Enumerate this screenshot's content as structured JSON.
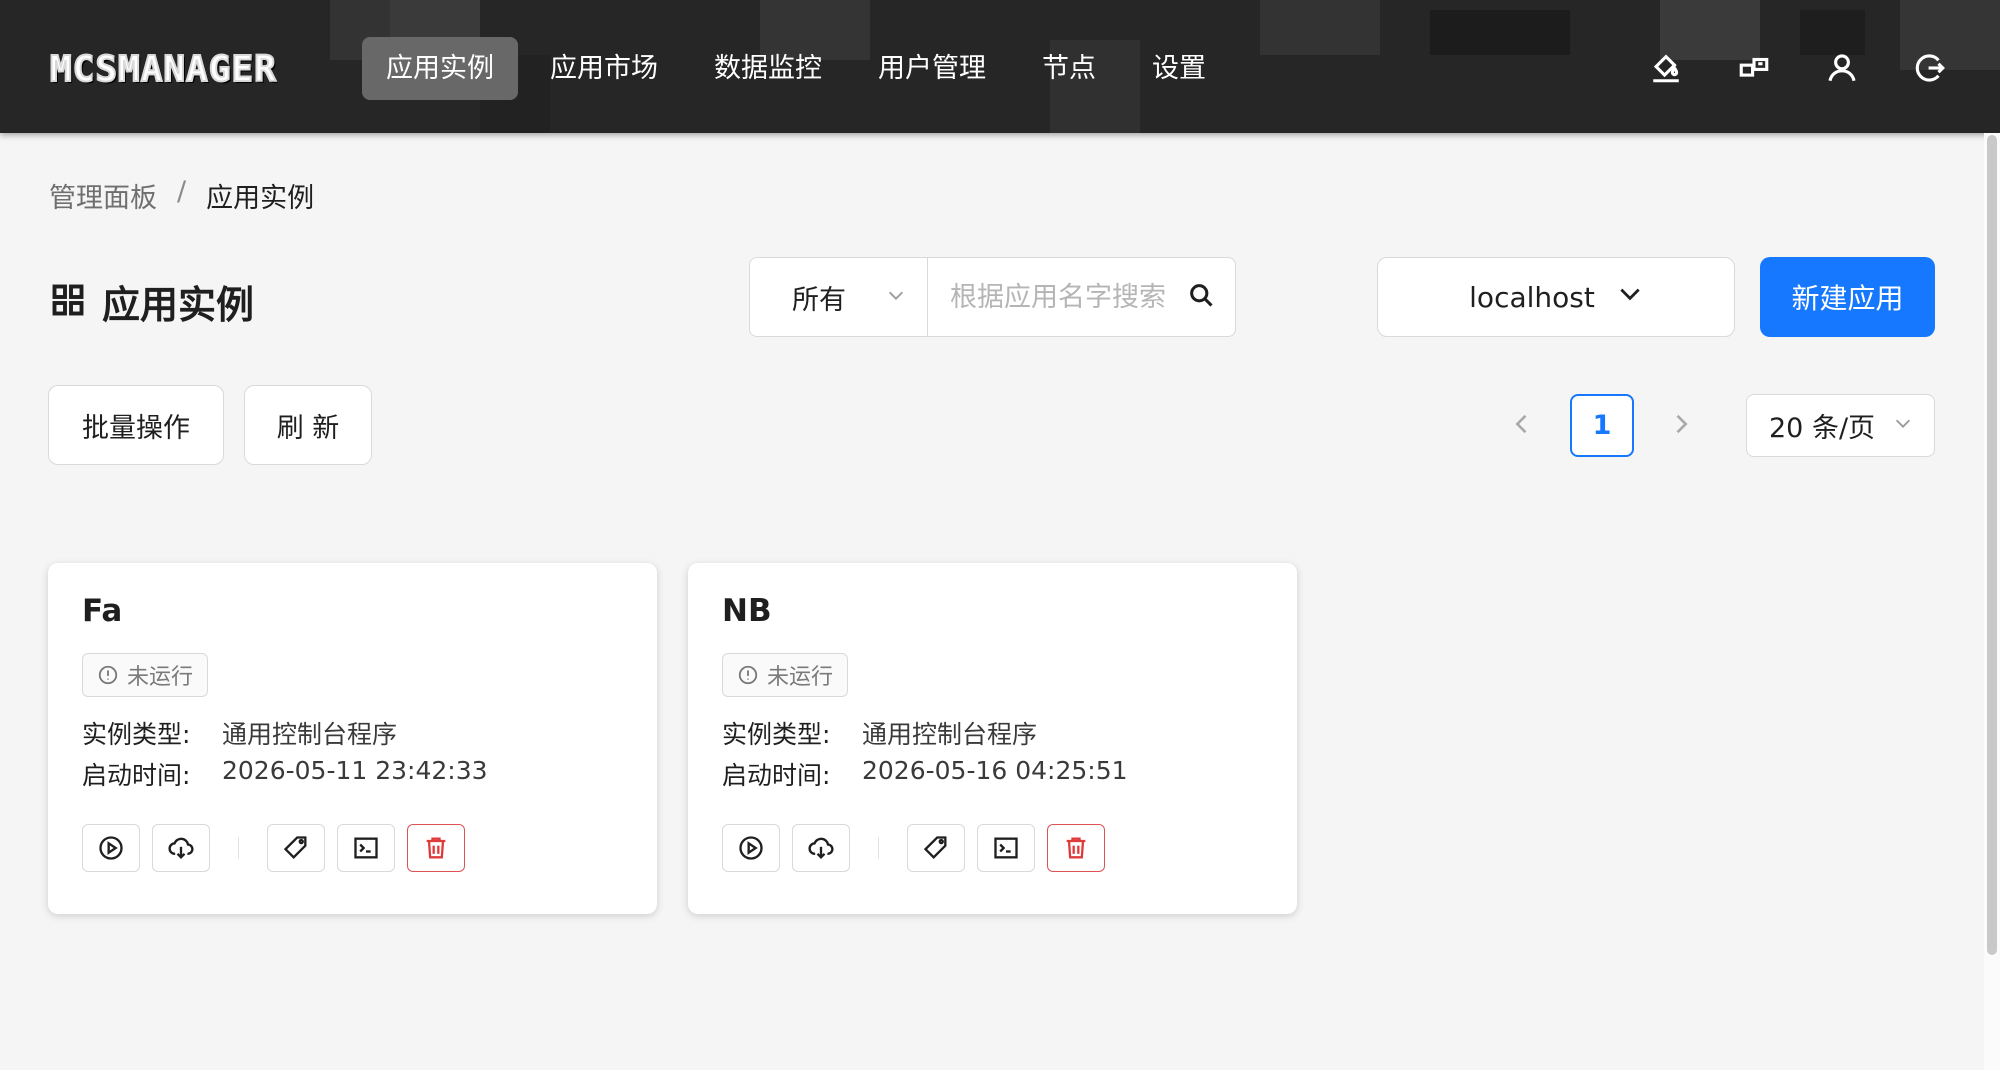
{
  "app": {
    "logo_text": "MCSMANAGER"
  },
  "nav": {
    "items": [
      {
        "label": "应用实例",
        "active": true
      },
      {
        "label": "应用市场",
        "active": false
      },
      {
        "label": "数据监控",
        "active": false
      },
      {
        "label": "用户管理",
        "active": false
      },
      {
        "label": "节点",
        "active": false
      },
      {
        "label": "设置",
        "active": false
      }
    ],
    "icons": [
      "paint-bucket-icon",
      "language-icon",
      "user-icon",
      "logout-icon"
    ]
  },
  "breadcrumb": {
    "parent": "管理面板",
    "separator": "/",
    "current": "应用实例"
  },
  "page": {
    "title": "应用实例",
    "filter_value": "所有",
    "search_placeholder": "根据应用名字搜索",
    "node_value": "localhost",
    "new_app_label": "新建应用",
    "batch_label": "批量操作",
    "refresh_label": "刷 新"
  },
  "pagination": {
    "current_page": "1",
    "page_size": "20 条/页"
  },
  "instances": [
    {
      "name": "Fa",
      "status": "未运行",
      "type_label": "实例类型:",
      "type_value": "通用控制台程序",
      "time_label": "启动时间:",
      "time_value": "2026-05-11 23:42:33"
    },
    {
      "name": "NB",
      "status": "未运行",
      "type_label": "实例类型:",
      "type_value": "通用控制台程序",
      "time_label": "启动时间:",
      "time_value": "2026-05-16 04:25:51"
    }
  ],
  "colors": {
    "primary": "#1677ff",
    "topbar": "#2b2b2b",
    "nav_active": "#686868",
    "danger": "#e03b3b",
    "background": "#f5f5f5"
  }
}
